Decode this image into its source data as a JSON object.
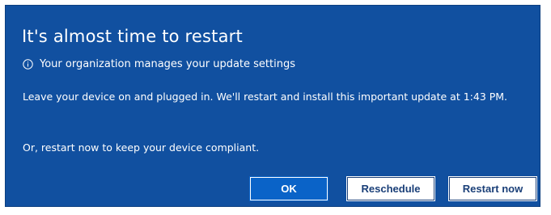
{
  "dialog": {
    "title": "It's almost time to restart",
    "org_notice": {
      "icon": "info-icon",
      "text": "Your organization manages your update settings"
    },
    "body": "Leave your device on and plugged in. We'll restart and install this important update at 1:43 PM.",
    "secondary": "Or, restart now to keep your device compliant.",
    "buttons": {
      "ok_label": "OK",
      "reschedule_label": "Reschedule",
      "restart_now_label": "Restart now"
    },
    "colors": {
      "background": "#1150a0",
      "primary_button": "#0a63c8",
      "text": "#ffffff"
    }
  }
}
